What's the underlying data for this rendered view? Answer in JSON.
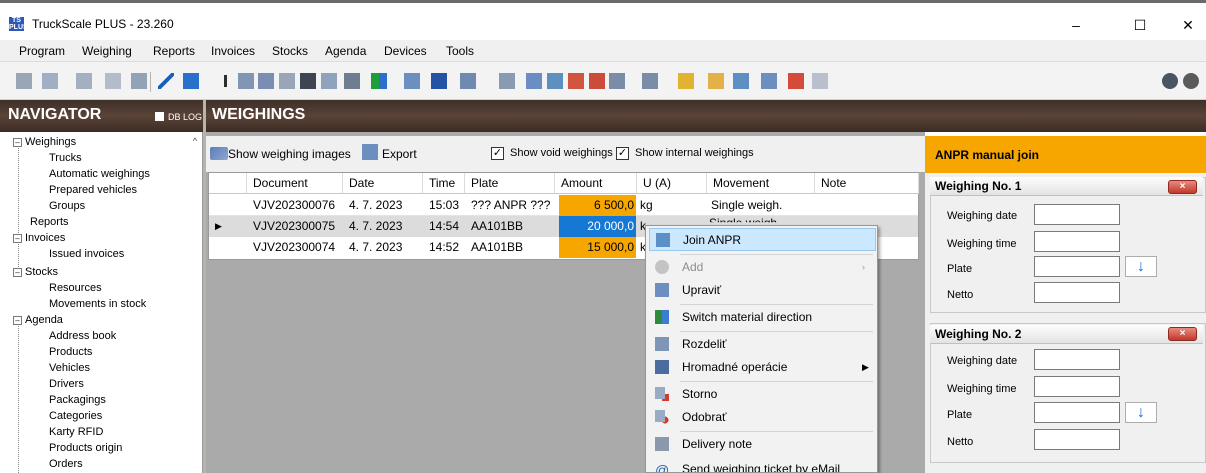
{
  "window": {
    "title": "TruckScale PLUS - 23.260",
    "logo_text": "TS PLUS",
    "controls": {
      "minimize": "–",
      "maximize": "☐",
      "close": "✕"
    }
  },
  "menu": [
    "Program",
    "Weighing",
    "Reports",
    "Invoices",
    "Stocks",
    "Agenda",
    "Devices",
    "Tools"
  ],
  "navigator": {
    "title": "NAVIGATOR",
    "dblog_label": "DB LOG",
    "tree": [
      {
        "label": "Weighings",
        "expanded": true,
        "children": [
          "Trucks",
          "Automatic weighings",
          "Prepared vehicles",
          "Groups"
        ]
      },
      {
        "label": "Reports"
      },
      {
        "label": "Invoices",
        "expanded": true,
        "children": [
          "Issued invoices"
        ]
      },
      {
        "label": "Stocks",
        "expanded": true,
        "children": [
          "Resources",
          "Movements in stock"
        ]
      },
      {
        "label": "Agenda",
        "expanded": true,
        "children": [
          "Address book",
          "Products",
          "Vehicles",
          "Drivers",
          "Packagings",
          "Categories",
          "Karty RFID",
          "Products origin",
          "Orders"
        ]
      }
    ]
  },
  "weighings": {
    "title": "WEIGHINGS",
    "toolbar": {
      "show_images": "Show weighing images",
      "export": "Export",
      "show_void": "Show void weighings",
      "show_void_checked": true,
      "show_internal": "Show internal weighings",
      "show_internal_checked": true
    },
    "columns": [
      "Document",
      "Date",
      "Time",
      "Plate",
      "Amount",
      "U (A)",
      "Movement",
      "Note"
    ],
    "rows": [
      {
        "document": "VJV202300076",
        "date": "4. 7. 2023",
        "time": "15:03",
        "plate": "??? ANPR ???",
        "amount": "6 500,0",
        "unit": "kg",
        "movement": "Single weigh.",
        "note": "",
        "selected": false
      },
      {
        "document": "VJV202300075",
        "date": "4. 7. 2023",
        "time": "14:54",
        "plate": "AA101BB",
        "amount": "20 000,0",
        "unit": "k",
        "movement": "",
        "note": "",
        "selected": true
      },
      {
        "document": "VJV202300074",
        "date": "4. 7. 2023",
        "time": "14:52",
        "plate": "AA101BB",
        "amount": "15 000,0",
        "unit": "k",
        "movement": "",
        "note": "",
        "selected": false
      }
    ],
    "hidden_movement_text": "Single weigh."
  },
  "context_menu": [
    {
      "label": "Join ANPR",
      "icon": "join-anpr-icon",
      "highlighted": true
    },
    {
      "label": "Add",
      "icon": "add-icon",
      "disabled": true,
      "submenu": true
    },
    {
      "label": "Upraviť",
      "icon": "edit-icon"
    },
    {
      "label": "Switch material direction",
      "icon": "switch-direction-icon"
    },
    {
      "label": "Rozdeliť",
      "icon": "split-icon"
    },
    {
      "label": "Hromadné operácie",
      "icon": "bulk-operations-icon",
      "submenu": true
    },
    {
      "label": "Storno",
      "icon": "storno-icon"
    },
    {
      "label": "Odobrať",
      "icon": "remove-icon"
    },
    {
      "label": "Delivery note",
      "icon": "delivery-note-icon"
    },
    {
      "label": "Send weighing ticket by eMail",
      "icon": "email-icon"
    }
  ],
  "anpr": {
    "title": "ANPR manual join",
    "weighing1": {
      "title": "Weighing No. 1",
      "date_label": "Weighing date",
      "time_label": "Weighing time",
      "plate_label": "Plate",
      "netto_label": "Netto"
    },
    "weighing2": {
      "title": "Weighing No. 2",
      "date_label": "Weighing date",
      "time_label": "Weighing time",
      "plate_label": "Plate",
      "netto_label": "Netto"
    },
    "close_button": "×",
    "arrow_button": "↓"
  },
  "colors": {
    "amount_orange": "#f7a600",
    "amount_selected": "#1478d4",
    "header_dark": "#4a3a30",
    "anpr_header": "#f7a600",
    "highlight": "#cce8ff"
  }
}
